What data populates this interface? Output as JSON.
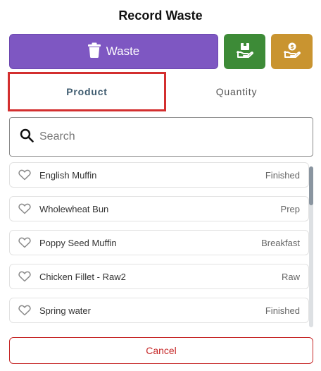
{
  "header": {
    "title": "Record Waste"
  },
  "actions": {
    "waste_label": "Waste",
    "waste_icon": "trash-icon",
    "transfer_icon": "hand-box-icon",
    "sale_icon": "hand-coin-icon",
    "colors": {
      "waste": "#7e57c2",
      "transfer": "#3d8b37",
      "sale": "#c99430"
    }
  },
  "tabs": [
    {
      "label": "Product",
      "selected": true
    },
    {
      "label": "Quantity",
      "selected": false
    }
  ],
  "search": {
    "placeholder": "Search",
    "value": ""
  },
  "products": [
    {
      "name": "English Muffin",
      "category": "Finished"
    },
    {
      "name": "Wholewheat Bun",
      "category": "Prep"
    },
    {
      "name": "Poppy Seed Muffin",
      "category": "Breakfast"
    },
    {
      "name": "Chicken Fillet - Raw2",
      "category": "Raw"
    },
    {
      "name": "Spring water",
      "category": "Finished"
    }
  ],
  "footer": {
    "cancel_label": "Cancel",
    "cancel_color": "#c62828"
  }
}
